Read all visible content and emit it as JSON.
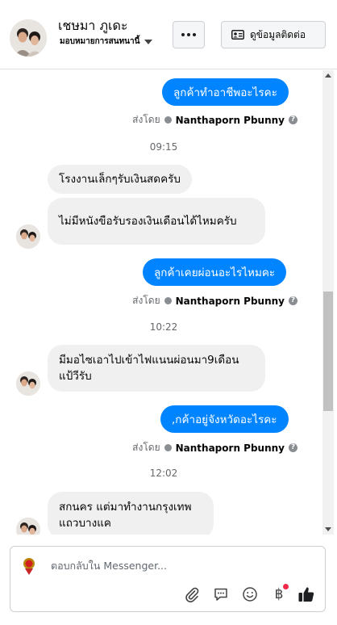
{
  "header": {
    "contact_name": "เชษมา ภูเดะ",
    "assign_label": "มอบหมายการสนทนานี้",
    "contact_info_label": "ดูข้อมูลติดต่อ"
  },
  "messages": [
    {
      "direction": "out",
      "text": "ลูกค้าทำอาชีพอะไรคะ"
    },
    {
      "direction": "sent_by",
      "prefix": "ส่งโดย",
      "name": "Nanthaporn Pbunny"
    },
    {
      "direction": "time",
      "text": "09:15"
    },
    {
      "direction": "in",
      "text": "โรงงานเล็กๆรับเงินสดครับ"
    },
    {
      "direction": "in",
      "text": "ไม่มีหนังขือรับรองเงินเดือนได้ไหมครับ"
    },
    {
      "direction": "out",
      "text": "ลูกค้าเคยผ่อนอะไรไหมคะ"
    },
    {
      "direction": "sent_by",
      "prefix": "ส่งโดย",
      "name": "Nanthaporn Pbunny"
    },
    {
      "direction": "time",
      "text": "10:22"
    },
    {
      "direction": "in",
      "text": "มีมอไซเอาไปเข้าไฟแนนผ่อนมา9เดือนแป้วีรับ"
    },
    {
      "direction": "out",
      "text": ",กค้าอยู่จังหวัดอะไรคะ"
    },
    {
      "direction": "sent_by",
      "prefix": "ส่งโดย",
      "name": "Nanthaporn Pbunny"
    },
    {
      "direction": "time",
      "text": "12:02"
    },
    {
      "direction": "in",
      "text": "สกนคร แต่มาทำงานกรุงเทพแถวบางแค"
    }
  ],
  "composer": {
    "placeholder": "ตอบกลับใน Messenger...",
    "tools": [
      "paperclip-icon",
      "saved-reply-icon",
      "emoji-icon",
      "baht-payment-icon",
      "thumbs-up-icon"
    ],
    "baht_symbol": "฿"
  },
  "colors": {
    "outgoing_bubble": "#0084ff",
    "incoming_bubble": "#f0f0f0",
    "muted_text": "#65676b",
    "notification_dot": "#f02849"
  }
}
